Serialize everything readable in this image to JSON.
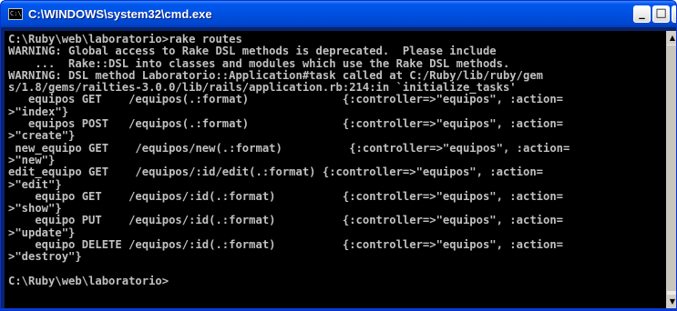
{
  "window": {
    "title": "C:\\WINDOWS\\system32\\cmd.exe",
    "icon_label": "C:\\",
    "buttons": {
      "minimize": "_",
      "maximize": "□",
      "close": "×"
    }
  },
  "console": {
    "lines": [
      "C:\\Ruby\\web\\laboratorio>rake routes",
      "WARNING: Global access to Rake DSL methods is deprecated.  Please include",
      "    ...  Rake::DSL into classes and modules which use the Rake DSL methods.",
      "WARNING: DSL method Laboratorio::Application#task called at C:/Ruby/lib/ruby/gem",
      "s/1.8/gems/railties-3.0.0/lib/rails/application.rb:214:in `initialize_tasks'",
      "   equipos GET    /equipos(.:format)              {:controller=>\"equipos\", :action=",
      ">\"index\"}",
      "   equipos POST   /equipos(.:format)              {:controller=>\"equipos\", :action=",
      ">\"create\"}",
      " new_equipo GET    /equipos/new(.:format)          {:controller=>\"equipos\", :action=",
      ">\"new\"}",
      "edit_equipo GET    /equipos/:id/edit(.:format) {:controller=>\"equipos\", :action=",
      ">\"edit\"}",
      "    equipo GET    /equipos/:id(.:format)          {:controller=>\"equipos\", :action=",
      ">\"show\"}",
      "    equipo PUT    /equipos/:id(.:format)          {:controller=>\"equipos\", :action=",
      ">\"update\"}",
      "    equipo DELETE /equipos/:id(.:format)          {:controller=>\"equipos\", :action=",
      ">\"destroy\"}",
      "",
      "C:\\Ruby\\web\\laboratorio>"
    ]
  },
  "scrollbar": {
    "up_arrow": "▲",
    "down_arrow": "▼"
  },
  "colors": {
    "titlebar": "#0054e3",
    "console_bg": "#000000",
    "console_text": "#c0c0c0"
  }
}
